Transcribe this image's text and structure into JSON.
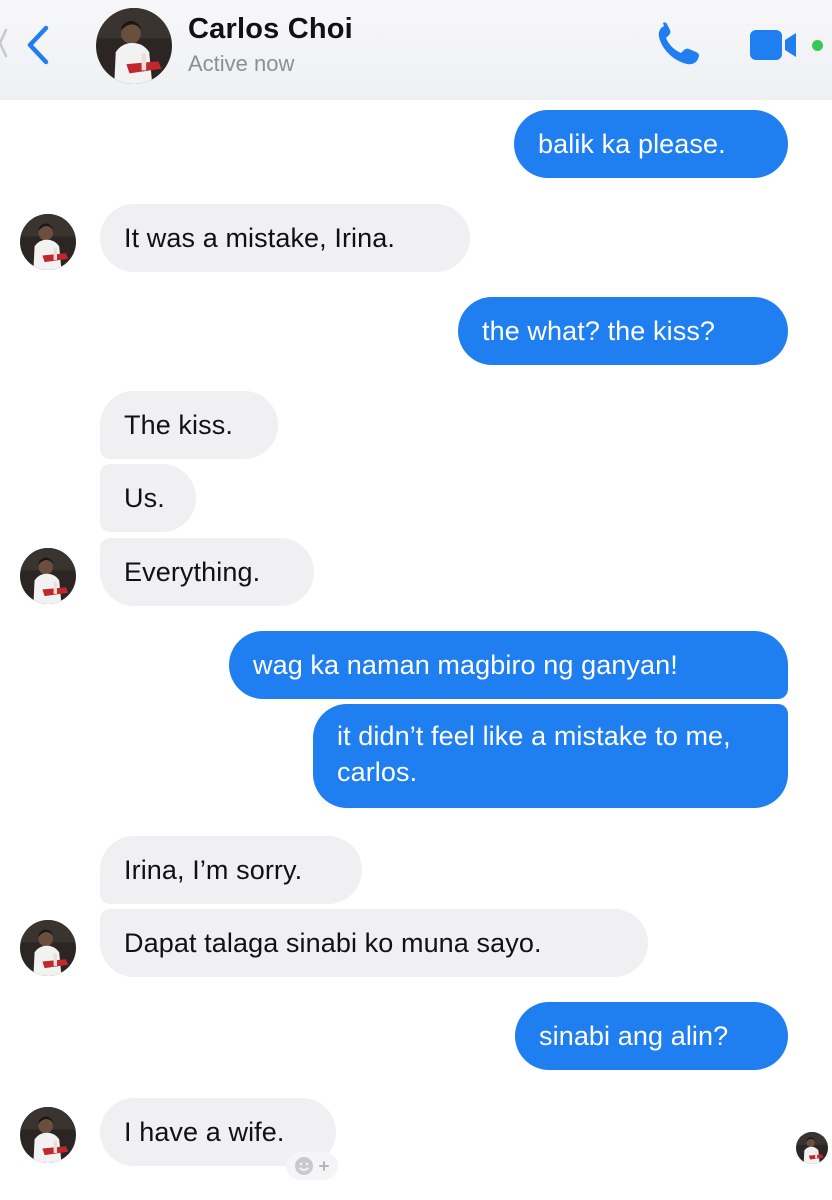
{
  "header": {
    "contact_name": "Carlos Choi",
    "status": "Active now",
    "accent_color": "#1f7ef0",
    "online_color": "#39c755",
    "icons": [
      "chevron-left-icon",
      "phone-icon",
      "video-camera-icon"
    ]
  },
  "messages": [
    {
      "side": "out",
      "text": "balik ka please."
    },
    {
      "side": "in",
      "text": "It was a mistake, Irina."
    },
    {
      "side": "out",
      "text": "the what? the kiss?"
    },
    {
      "side": "in",
      "text": "The kiss."
    },
    {
      "side": "in",
      "text": "Us."
    },
    {
      "side": "in",
      "text": "Everything."
    },
    {
      "side": "out",
      "text": "wag ka naman magbiro ng ganyan!"
    },
    {
      "side": "out",
      "text": "it didn’t feel like a mistake to me, carlos."
    },
    {
      "side": "in",
      "text": "Irina, I’m sorry."
    },
    {
      "side": "in",
      "text": "Dapat talaga sinabi ko muna sayo."
    },
    {
      "side": "out",
      "text": "sinabi ang alin?"
    },
    {
      "side": "in",
      "text": "I have a wife."
    }
  ],
  "colors": {
    "outgoing_bubble": "#1f7ef0",
    "incoming_bubble": "#f0f0f2"
  }
}
